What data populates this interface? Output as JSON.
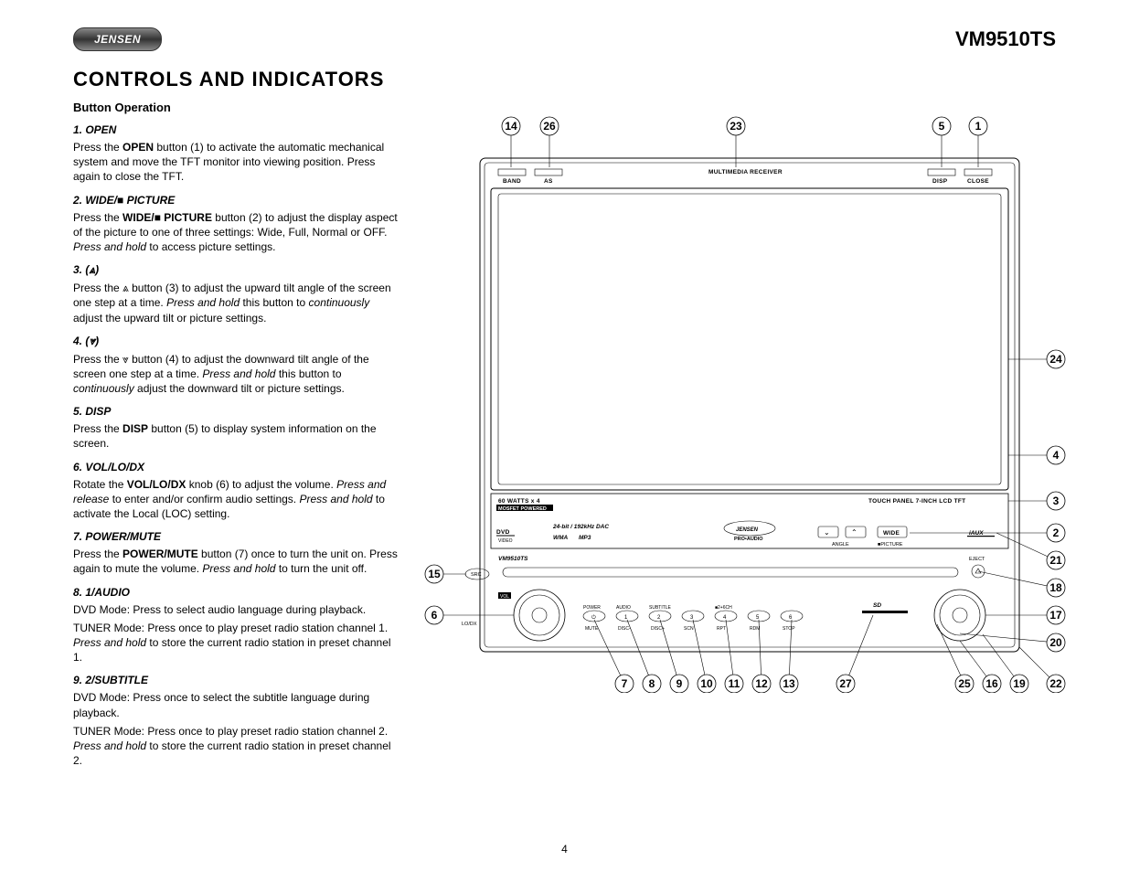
{
  "brand": "JENSEN",
  "model": "VM9510TS",
  "page_number": "4",
  "main_title": "CONTROLS AND INDICATORS",
  "sub_title": "Button Operation",
  "items": [
    {
      "title": "1. OPEN",
      "body_html": "Press the <b>OPEN</b> button (1) to activate the automatic mechanical system and move the TFT monitor into viewing position. Press again to close the TFT."
    },
    {
      "title": "2. WIDE/■ PICTURE",
      "body_html": "Press the <b>WIDE/■ PICTURE</b> button (2) to adjust the display aspect of the picture to one of three settings: Wide, Full, Normal or OFF. <i>Press and hold</i> to access picture settings."
    },
    {
      "title": "3. (⩓)",
      "body_html": "Press the ⩓ button (3) to adjust the upward tilt angle of the screen one step at a time. <i>Press and hold</i> this button to <i>continuously</i> adjust the upward tilt or picture settings."
    },
    {
      "title": "4. (⩔)",
      "body_html": "Press the ⩔ button (4) to adjust the downward tilt angle of the screen one step at a time. <i>Press and hold</i> this button to <i>continuously</i> adjust the downward tilt or picture settings."
    },
    {
      "title": "5. DISP",
      "body_html": "Press the <b>DISP</b> button (5) to display system information on the screen."
    },
    {
      "title": "6. VOL/LO/DX",
      "body_html": "Rotate the <b>VOL/LO/DX</b> knob (6) to adjust the volume. <i>Press and release</i> to enter and/or confirm audio settings. <i>Press and hold</i> to activate the Local (LOC) setting."
    },
    {
      "title": "7. POWER/MUTE",
      "body_html": "Press the <b>POWER/MUTE</b> button (7) once to turn the unit on. Press again to mute the volume. <i>Press and hold</i> to turn the unit off."
    },
    {
      "title": "8. 1/AUDIO",
      "body_html": "DVD Mode: Press to select audio language during playback.",
      "body2_html": "TUNER Mode: Press once to play preset radio station channel 1. <i>Press and hold</i> to store the current radio station in preset channel 1."
    },
    {
      "title": "9. 2/SUBTITLE",
      "body_html": "DVD Mode: Press once to select the subtitle language during playback.",
      "body2_html": "TUNER Mode: Press once to play preset radio station channel 2. <i>Press and hold</i> to store the current radio station in preset channel 2."
    }
  ],
  "diagram": {
    "top_labels": {
      "band": "BAND",
      "as": "AS",
      "title": "MULTIMEDIA RECEIVER",
      "disp": "DISP",
      "close": "CLOSE"
    },
    "mid_labels": {
      "watts": "60 WATTS x 4",
      "mosfet": "MOSFET POWERED",
      "touch": "TOUCH PANEL 7-INCH LCD TFT",
      "dac": "24-bit / 192kHz DAC",
      "dvd": "DVD",
      "video": "VIDEO",
      "wma": "WMA",
      "mp3": "MP3",
      "logo_center": "JENSEN",
      "pro_audio": "PRO•AUDIO",
      "wide": "WIDE",
      "angle": "ANGLE",
      "picture": "■PICTURE",
      "iaux": "iAUX",
      "model_small": "VM9510TS",
      "eject": "EJECT"
    },
    "bottom_row": {
      "src": "SRC",
      "vol": "VOL",
      "lodx": "LO/DX",
      "sd": "SD",
      "btn_top": [
        "POWER",
        "AUDIO",
        "SUBTITLE",
        "",
        "■2+6CH",
        "",
        ""
      ],
      "btn_mid": [
        "⏻",
        "1",
        "2",
        "3",
        "4",
        "5",
        "6"
      ],
      "btn_bot": [
        "MUTE",
        "DISC-",
        "DISC+",
        "SCN",
        "RPT",
        "RDM",
        "STOP"
      ]
    },
    "callouts": [
      "1",
      "2",
      "3",
      "4",
      "5",
      "6",
      "7",
      "8",
      "9",
      "10",
      "11",
      "12",
      "13",
      "14",
      "15",
      "16",
      "17",
      "18",
      "19",
      "20",
      "21",
      "22",
      "23",
      "24",
      "25",
      "26",
      "27"
    ]
  }
}
